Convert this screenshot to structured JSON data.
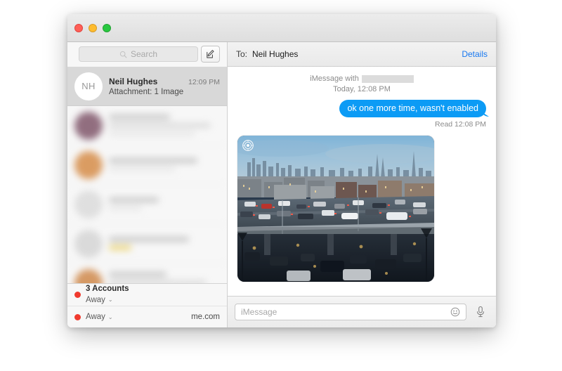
{
  "window": {
    "traffic_lights": [
      "close",
      "minimize",
      "maximize"
    ]
  },
  "sidebar": {
    "search": {
      "placeholder": "Search",
      "icon": "search-icon"
    },
    "compose": {
      "icon": "compose-icon",
      "label": "New Message"
    },
    "conversations": [
      {
        "avatar_initials": "NH",
        "name": "Neil Hughes",
        "time": "12:09 PM",
        "preview": "Attachment: 1 Image",
        "selected": true,
        "redacted": false
      },
      {
        "selected": false,
        "redacted": true
      },
      {
        "selected": false,
        "redacted": true
      },
      {
        "selected": false,
        "redacted": true
      },
      {
        "selected": false,
        "redacted": true
      },
      {
        "selected": false,
        "redacted": true
      }
    ],
    "accounts": {
      "title": "3 Accounts",
      "status_primary": "Away",
      "status_secondary": "Away",
      "domain": "me.com",
      "status_color": "#f03a2e",
      "chevron": "⌄"
    }
  },
  "thread": {
    "to_label": "To:",
    "to_value": "Neil Hughes",
    "details_label": "Details",
    "details_color": "#1878f0",
    "service_line": "iMessage with",
    "timestamp_line": "Today, 12:08 PM",
    "messages": [
      {
        "direction": "outgoing",
        "text": "ok one more time, wasn't enabled",
        "bubble_color": "#0c9bf5",
        "receipt": "Read 12:08 PM"
      },
      {
        "direction": "incoming",
        "type": "image",
        "alt": "Dusk cityscape photo of an elevated highway with heavy traffic and a city skyline",
        "badge_icon": "gear-icon"
      }
    ]
  },
  "compose": {
    "placeholder": "iMessage",
    "emoji_icon": "smiley-icon",
    "mic_icon": "microphone-icon"
  }
}
